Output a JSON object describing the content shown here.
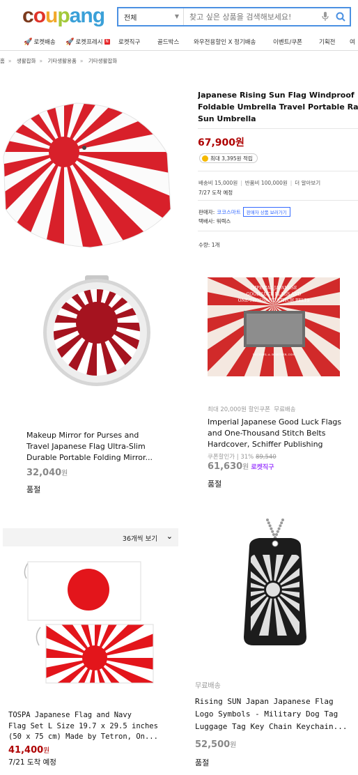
{
  "logo": {
    "text": "coupang",
    "letters": [
      "c",
      "o",
      "u",
      "p",
      "a",
      "n",
      "g"
    ],
    "colors": [
      "#7c3a1d",
      "#e0342a",
      "#f2a82a",
      "#a3c93a",
      "#3aa0d8",
      "#3aa0d8",
      "#3aa0d8"
    ]
  },
  "search": {
    "category": "전체",
    "placeholder": "찾고 싶은 상품을 검색해보세요!"
  },
  "nav": {
    "items": [
      "로켓배송",
      "로켓프레시",
      "로켓직구",
      "골드박스",
      "와우전용할인 X 정기배송",
      "이벤트/쿠폰",
      "기획전",
      "여"
    ]
  },
  "breadcrumb": [
    "홈",
    "생활잡화",
    "기타생활용품",
    "기타생활잡화"
  ],
  "product": {
    "title_lines": [
      "Japanese Rising Sun Flag Windproof",
      "Foldable Umbrella Travel Portable Rain",
      "Sun Umbrella"
    ],
    "price": "67,900원",
    "reward": "최대 3,395원 적립",
    "shipping_fee": "배송비 15,000원",
    "return_fee": "반품비 100,000원",
    "more": "더 알아보기",
    "arrival": "7/27 도착 예정",
    "seller_label": "판매자:",
    "seller_name": "코코스마트",
    "seller_button": "판매자 상품 보러가기",
    "courier": "택배사: 워렉스",
    "qty": "수량: 1개"
  },
  "grid": [
    {
      "title_lines": [
        "Makeup Mirror for Purses and",
        "Travel Japanese Flag Ultra-Slim",
        "Durable Portable Folding Mirror..."
      ],
      "price": "32,040",
      "unit": "원",
      "status": "품절"
    },
    {
      "coupon_line": "최대 20,000원 할인쿠폰",
      "free_ship": "무료배송",
      "title_lines": [
        "Imperial Japanese Good Luck Flags",
        "and One-Thousand Stitch Belts",
        "Hardcover, Schiffer Publishing"
      ],
      "discount_prefix": "쿠폰할인가 | 31%",
      "original_price": "89,540",
      "price": "61,630",
      "unit": "원",
      "badge": "로켓직구",
      "status": "품절",
      "book_title_lines": [
        "IMPERIAL JAPANESE",
        "GOOD LUCK FLAGS AND",
        "ONE-THOUSAND STITCH BELTS"
      ],
      "book_author": "MICHAEL A. BORTNER, DDS"
    },
    {
      "title_lines": [
        "TOSPA Japanese Flag and Navy",
        "Flag Set L Size 19.7 x 29.5 inches",
        "(50 x 75 cm) Made by Tetron, On..."
      ],
      "price": "41,400",
      "unit": "원",
      "arrival": "7/21 도착 예정"
    },
    {
      "free_ship": "무료배송",
      "title_lines": [
        "Rising SUN Japan Japanese Flag",
        "Logo Symbols - Military Dog Tag",
        "Luggage Tag Key Chain Keychain..."
      ],
      "price": "52,500",
      "unit": "원",
      "status": "품절"
    }
  ],
  "view_select": {
    "label": "36개씩 보기"
  },
  "colors": {
    "price_red": "#ae0000",
    "search_blue": "#4a90e2",
    "link_blue": "#346aff",
    "flag_red": "#d8202a",
    "rocket_purple": "#a045ff"
  }
}
